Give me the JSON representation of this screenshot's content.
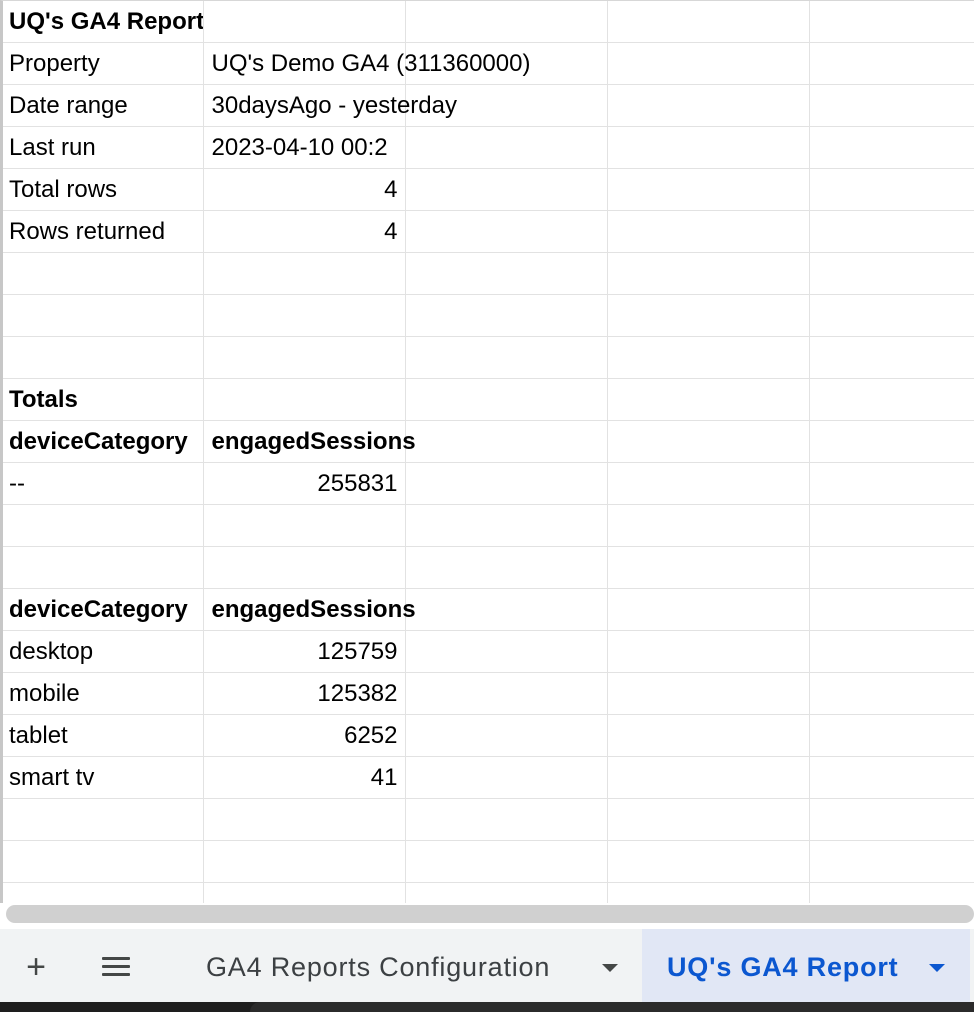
{
  "sheet": {
    "rows": [
      [
        {
          "text": "UQ's GA4 Report",
          "bold": true
        },
        {
          "text": ""
        },
        {
          "text": ""
        },
        {
          "text": ""
        },
        {
          "text": ""
        }
      ],
      [
        {
          "text": "Property"
        },
        {
          "text": "UQ's Demo GA4 (311360000)",
          "spill": true
        },
        {
          "text": ""
        },
        {
          "text": ""
        },
        {
          "text": ""
        }
      ],
      [
        {
          "text": "Date range"
        },
        {
          "text": "30daysAgo - yesterday",
          "spill": true
        },
        {
          "text": ""
        },
        {
          "text": ""
        },
        {
          "text": ""
        }
      ],
      [
        {
          "text": "Last run"
        },
        {
          "text": "2023-04-10 00:2"
        },
        {
          "text": ""
        },
        {
          "text": ""
        },
        {
          "text": ""
        }
      ],
      [
        {
          "text": "Total rows"
        },
        {
          "text": "4",
          "num": true
        },
        {
          "text": ""
        },
        {
          "text": ""
        },
        {
          "text": ""
        }
      ],
      [
        {
          "text": "Rows returned"
        },
        {
          "text": "4",
          "num": true
        },
        {
          "text": ""
        },
        {
          "text": ""
        },
        {
          "text": ""
        }
      ],
      [
        {
          "text": ""
        },
        {
          "text": ""
        },
        {
          "text": ""
        },
        {
          "text": ""
        },
        {
          "text": ""
        }
      ],
      [
        {
          "text": ""
        },
        {
          "text": ""
        },
        {
          "text": ""
        },
        {
          "text": ""
        },
        {
          "text": ""
        }
      ],
      [
        {
          "text": ""
        },
        {
          "text": ""
        },
        {
          "text": ""
        },
        {
          "text": ""
        },
        {
          "text": ""
        }
      ],
      [
        {
          "text": "Totals",
          "bold": true
        },
        {
          "text": ""
        },
        {
          "text": ""
        },
        {
          "text": ""
        },
        {
          "text": ""
        }
      ],
      [
        {
          "text": "deviceCategory",
          "bold": true
        },
        {
          "text": "engagedSessions",
          "bold": true,
          "spill": true
        },
        {
          "text": ""
        },
        {
          "text": ""
        },
        {
          "text": ""
        }
      ],
      [
        {
          "text": "--"
        },
        {
          "text": "255831",
          "num": true
        },
        {
          "text": ""
        },
        {
          "text": ""
        },
        {
          "text": ""
        }
      ],
      [
        {
          "text": ""
        },
        {
          "text": ""
        },
        {
          "text": ""
        },
        {
          "text": ""
        },
        {
          "text": ""
        }
      ],
      [
        {
          "text": ""
        },
        {
          "text": ""
        },
        {
          "text": ""
        },
        {
          "text": ""
        },
        {
          "text": ""
        }
      ],
      [
        {
          "text": "deviceCategory",
          "bold": true
        },
        {
          "text": "engagedSessions",
          "bold": true,
          "spill": true
        },
        {
          "text": ""
        },
        {
          "text": ""
        },
        {
          "text": ""
        }
      ],
      [
        {
          "text": "desktop"
        },
        {
          "text": "125759",
          "num": true
        },
        {
          "text": ""
        },
        {
          "text": ""
        },
        {
          "text": ""
        }
      ],
      [
        {
          "text": "mobile"
        },
        {
          "text": "125382",
          "num": true
        },
        {
          "text": ""
        },
        {
          "text": ""
        },
        {
          "text": ""
        }
      ],
      [
        {
          "text": "tablet"
        },
        {
          "text": "6252",
          "num": true
        },
        {
          "text": ""
        },
        {
          "text": ""
        },
        {
          "text": ""
        }
      ],
      [
        {
          "text": "smart tv"
        },
        {
          "text": "41",
          "num": true
        },
        {
          "text": ""
        },
        {
          "text": ""
        },
        {
          "text": ""
        }
      ],
      [
        {
          "text": ""
        },
        {
          "text": ""
        },
        {
          "text": ""
        },
        {
          "text": ""
        },
        {
          "text": ""
        }
      ],
      [
        {
          "text": ""
        },
        {
          "text": ""
        },
        {
          "text": ""
        },
        {
          "text": ""
        },
        {
          "text": ""
        }
      ],
      [
        {
          "text": ""
        },
        {
          "text": ""
        },
        {
          "text": ""
        },
        {
          "text": ""
        },
        {
          "text": ""
        }
      ]
    ]
  },
  "tabbar": {
    "add_label": "+",
    "add_icon": "plus-icon",
    "menu_icon": "hamburger-menu-icon",
    "tabs": [
      {
        "label": "GA4 Reports Configuration",
        "active": false,
        "icon": "caret-down-icon"
      },
      {
        "label": "UQ's GA4 Report",
        "active": true,
        "icon": "caret-down-icon"
      }
    ]
  },
  "colors": {
    "active_tab_bg": "#e1e7f5",
    "active_tab_text": "#0b57d0",
    "tabbar_bg": "#f1f3f4",
    "gridline": "#e2e2e2"
  }
}
